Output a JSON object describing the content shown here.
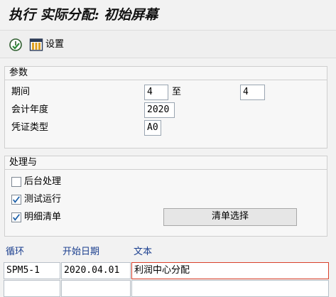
{
  "title": "执行 实际分配: 初始屏幕",
  "toolbar": {
    "settings_label": "设置"
  },
  "params": {
    "header": "参数",
    "period_label": "期间",
    "period_from": "4",
    "to_label": "至",
    "period_to": "4",
    "fiscal_year_label": "会计年度",
    "fiscal_year": "2020",
    "doc_type_label": "凭证类型",
    "doc_type": "A0"
  },
  "processing": {
    "header": "处理与",
    "background_label": "后台处理",
    "background_checked": false,
    "test_run_label": "测试运行",
    "test_run_checked": true,
    "detail_list_label": "明细清单",
    "detail_list_checked": true,
    "list_select_label": "清单选择"
  },
  "cycles": {
    "headers": {
      "cycle": "循环",
      "start_date": "开始日期",
      "text": "文本"
    },
    "rows": [
      {
        "cycle": "SPM5-1",
        "start_date": "2020.04.01",
        "text": "利润中心分配"
      },
      {
        "cycle": "",
        "start_date": "",
        "text": ""
      }
    ]
  },
  "colors": {
    "accent_blue": "#1b3f8f",
    "focus_red": "#d9412b",
    "check_blue": "#1b5fa8"
  }
}
